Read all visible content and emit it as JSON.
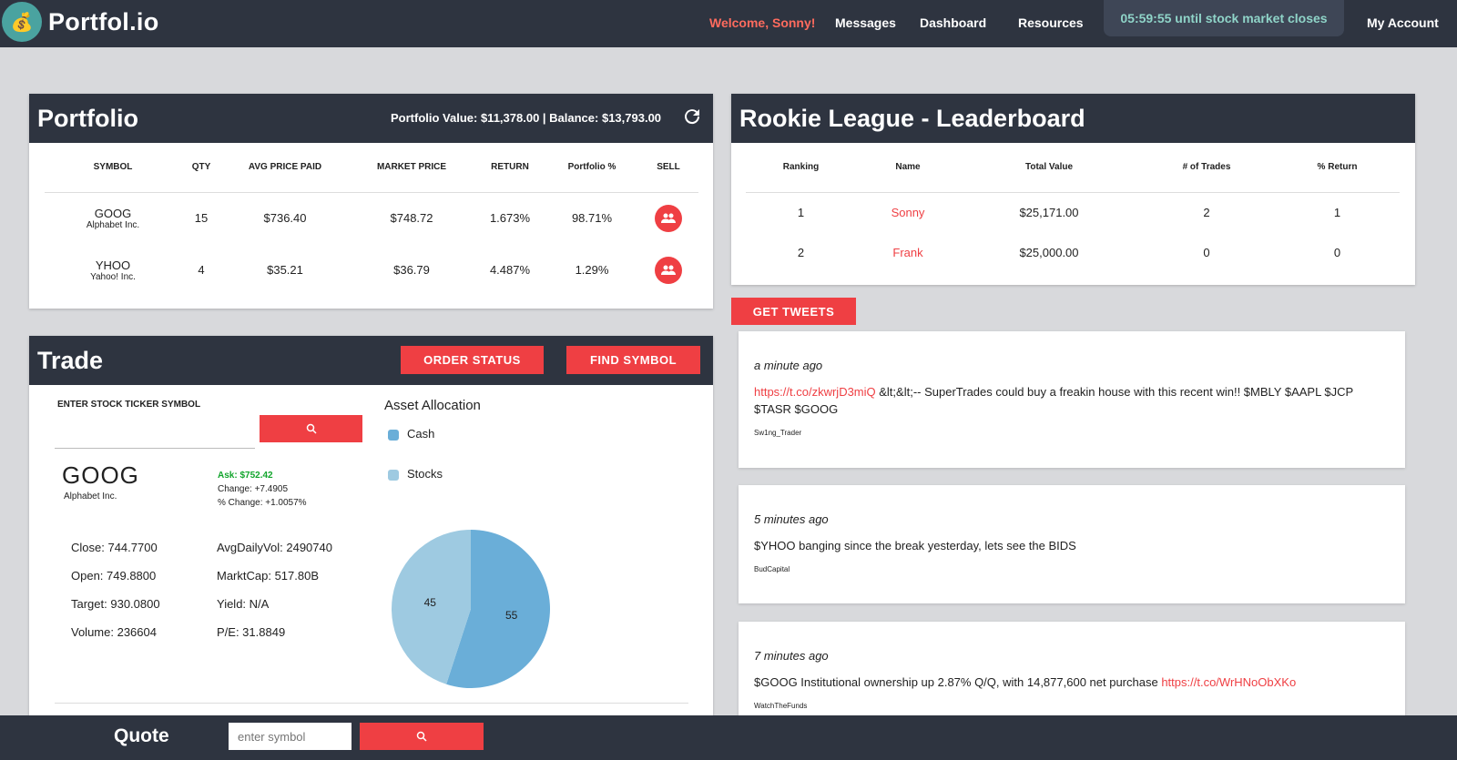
{
  "nav": {
    "brand": "Portfol.io",
    "welcome": "Welcome, Sonny!",
    "messages": "Messages",
    "dashboard": "Dashboard",
    "resources": "Resources",
    "timer": "05:59:55 until stock market closes",
    "account": "My Account"
  },
  "portfolio": {
    "title": "Portfolio",
    "summary": "Portfolio Value: $11,378.00 | Balance: $13,793.00",
    "columns": [
      "SYMBOL",
      "QTY",
      "AVG PRICE PAID",
      "MARKET PRICE",
      "RETURN",
      "Portfolio %",
      "SELL"
    ],
    "rows": [
      {
        "symbol": "GOOG",
        "name": "Alphabet Inc.",
        "qty": "15",
        "avg": "$736.40",
        "market": "$748.72",
        "return": "1.673%",
        "pct": "98.71%"
      },
      {
        "symbol": "YHOO",
        "name": "Yahoo! Inc.",
        "qty": "4",
        "avg": "$35.21",
        "market": "$36.79",
        "return": "4.487%",
        "pct": "1.29%"
      }
    ]
  },
  "leaderboard": {
    "title": "Rookie League - Leaderboard",
    "columns": [
      "Ranking",
      "Name",
      "Total Value",
      "# of Trades",
      "% Return"
    ],
    "rows": [
      {
        "rank": "1",
        "name": "Sonny",
        "value": "$25,171.00",
        "trades": "2",
        "ret": "1"
      },
      {
        "rank": "2",
        "name": "Frank",
        "value": "$25,000.00",
        "trades": "0",
        "ret": "0"
      }
    ]
  },
  "trade": {
    "title": "Trade",
    "order_status": "ORDER STATUS",
    "find_symbol": "FIND SYMBOL",
    "ticker_label": "ENTER STOCK TICKER SYMBOL",
    "symbol": "GOOG",
    "company": "Alphabet Inc.",
    "ask": "Ask: $752.42",
    "change": "Change: +7.4905",
    "pct_change": "% Change: +1.0057%",
    "close": "Close: 744.7700",
    "open": "Open: 749.8800",
    "target": "Target: 930.0800",
    "volume": "Volume: 236604",
    "avg_vol": "AvgDailyVol: 2490740",
    "mkt_cap": "MarktCap: 517.80B",
    "yield": "Yield: N/A",
    "pe": "P/E: 31.8849"
  },
  "allocation": {
    "title": "Asset Allocation",
    "legend_cash": "Cash",
    "legend_stocks": "Stocks",
    "cash_color": "#6aaed8",
    "stocks_color": "#9ecae1"
  },
  "chart_data": {
    "type": "pie",
    "title": "Asset Allocation",
    "categories": [
      "Cash",
      "Stocks"
    ],
    "values": [
      55,
      45
    ],
    "legend": "top-left"
  },
  "tweets": {
    "button": "GET TWEETS",
    "items": [
      {
        "time": "a minute ago",
        "link": "https://t.co/zkwrjD3miQ",
        "text": " &lt;&lt;-- SuperTrades could buy a freakin house with this recent win!! $MBLY $AAPL $JCP $TASR $GOOG",
        "user": "Sw1ng_Trader"
      },
      {
        "time": "5 minutes ago",
        "text": "$YHOO banging since the break yesterday, lets see the BIDS",
        "user": "BudCapital"
      },
      {
        "time": "7 minutes ago",
        "text": "$GOOG Institutional ownership up 2.87% Q/Q, with 14,877,600 net purchase ",
        "link": "https://t.co/WrHNoObXKo",
        "user": "WatchTheFunds"
      }
    ]
  },
  "quote": {
    "label": "Quote",
    "placeholder": "enter symbol"
  }
}
